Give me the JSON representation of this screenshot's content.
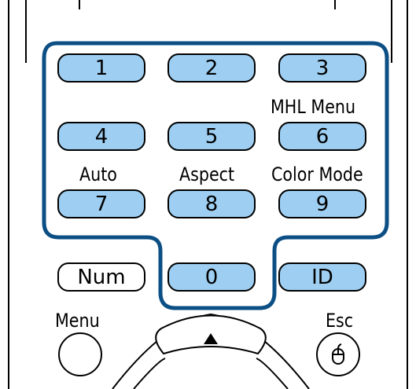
{
  "keypad": {
    "keys": [
      {
        "label": "1"
      },
      {
        "label": "2"
      },
      {
        "label": "3"
      },
      {
        "label": "4"
      },
      {
        "label": "5"
      },
      {
        "label": "6"
      },
      {
        "label": "7"
      },
      {
        "label": "8"
      },
      {
        "label": "9"
      },
      {
        "label": "0"
      }
    ],
    "function_labels": {
      "key6": "MHL Menu",
      "key7": "Auto",
      "key8": "Aspect",
      "key9": "Color Mode"
    }
  },
  "buttons": {
    "num": "Num",
    "id": "ID",
    "menu": "Menu",
    "esc": "Esc"
  },
  "colors": {
    "key_fill": "#9ecff2",
    "highlight_outline": "#0b4f85"
  }
}
